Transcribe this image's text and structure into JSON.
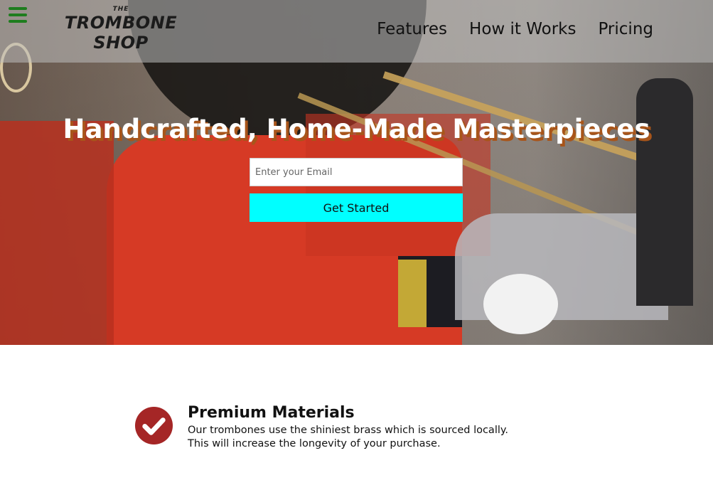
{
  "header": {
    "logo": {
      "small": "THE",
      "line1": "TROMBONE",
      "line2": "SHOP"
    },
    "nav": [
      {
        "label": "Features"
      },
      {
        "label": "How it Works"
      },
      {
        "label": "Pricing"
      }
    ],
    "menu_icon": "hamburger-menu-icon"
  },
  "hero": {
    "title": "Handcrafted, Home-Made Masterpieces",
    "email_placeholder": "Enter your Email",
    "cta_label": "Get Started"
  },
  "features": [
    {
      "icon": "check-circle-icon",
      "title": "Premium Materials",
      "description_line1": "Our trombones use the shiniest brass which is sourced locally.",
      "description_line2": "This will increase the longevity of your purchase."
    }
  ],
  "colors": {
    "menu_icon": "#1e7d1e",
    "cta_background": "#00ffff",
    "check_icon": "#a52626",
    "title_shadow": "#a8551a"
  }
}
